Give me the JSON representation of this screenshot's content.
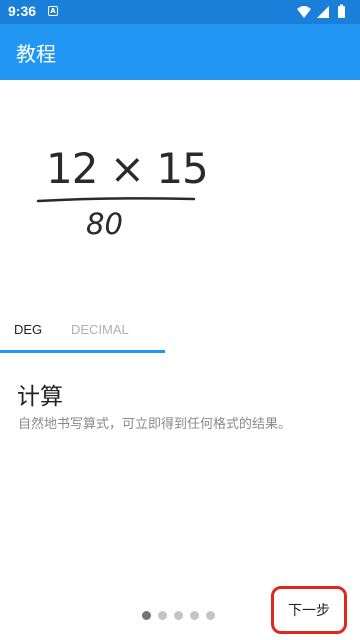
{
  "status_bar": {
    "time": "9:36",
    "notification_glyph": "A",
    "icons": [
      "wifi-icon",
      "cellular-signal-icon",
      "battery-icon"
    ]
  },
  "app_bar": {
    "title": "教程",
    "color": "#2196f3"
  },
  "illustration": {
    "expression": "12 × 15",
    "result": "80"
  },
  "tabs": [
    {
      "label": "DEG",
      "active": true
    },
    {
      "label": "DECIMAL",
      "active": false
    }
  ],
  "section": {
    "heading": "计算",
    "description": "自然地书写算式，可立即得到任何格式的结果。"
  },
  "pager": {
    "total": 5,
    "current": 1
  },
  "next_button": {
    "label": "下一步",
    "highlight_color": "#e0281e"
  }
}
